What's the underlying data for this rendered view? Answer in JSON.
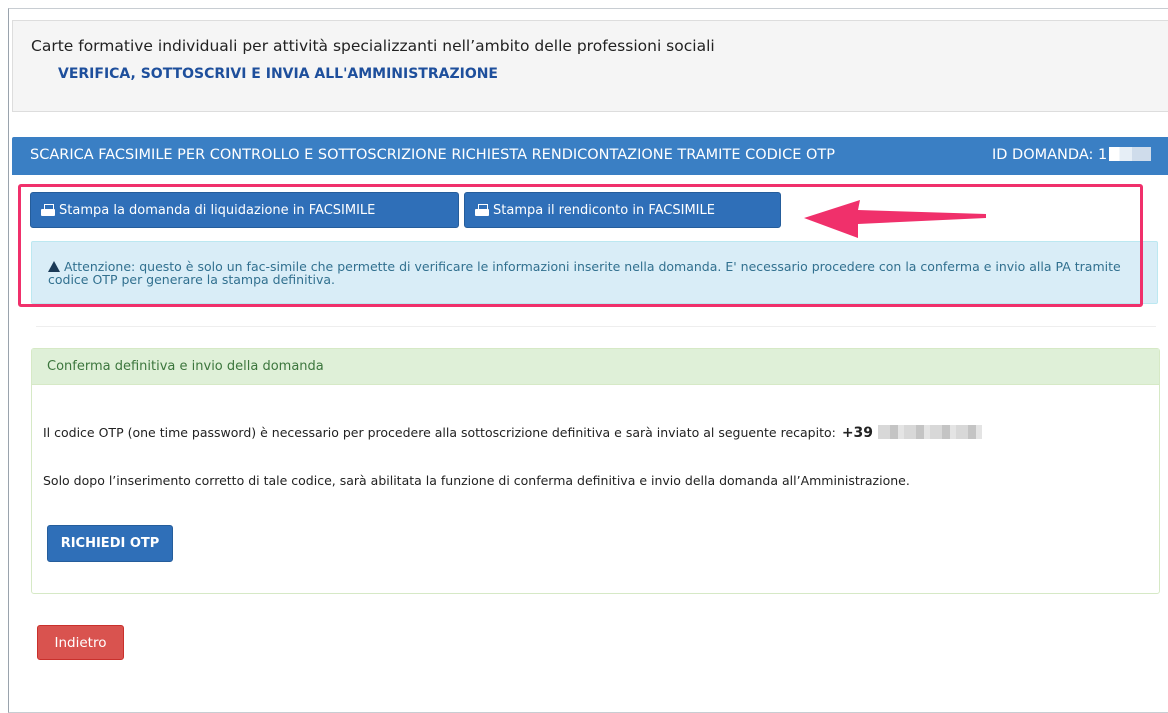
{
  "header": {
    "subtitle": "Carte formative individuali per attività specializzanti nell’ambito delle professioni sociali",
    "title": "VERIFICA, SOTTOSCRIVI E INVIA ALL'AMMINISTRAZIONE"
  },
  "section": {
    "title": "SCARICA FACSIMILE PER CONTROLLO E SOTTOSCRIZIONE RICHIESTA RENDICONTAZIONE TRAMITE CODICE OTP",
    "id_label": "ID DOMANDA: 1"
  },
  "actions": {
    "print_application_label": "Stampa la domanda di liquidazione in FACSIMILE",
    "print_report_label": "Stampa il rendiconto in FACSIMILE"
  },
  "alert": {
    "icon": "warning-icon",
    "text": "Attenzione: questo è solo un fac-simile che permette di verificare le informazioni inserite nella domanda. E' necessario procedere con la conferma e invio alla PA tramite codice OTP per generare la stampa definitiva."
  },
  "confirm": {
    "heading": "Conferma definitiva e invio della domanda",
    "otp_text": "Il codice OTP (one time password) è necessario per procedere alla sottoscrizione definitiva e sarà inviato al seguente recapito:",
    "phone_prefix": "+39",
    "enable_text": "Solo dopo l’inserimento corretto di tale codice, sarà abilitata la funzione di conferma definitiva e invio della domanda all’Amministrazione.",
    "request_otp_label": "RICHIEDI OTP"
  },
  "footer": {
    "back_label": "Indietro"
  },
  "colors": {
    "primary": "#3a7fc4",
    "button_blue": "#2f6fb8",
    "title_blue": "#1e4f9c",
    "highlight": "#f0306b",
    "danger": "#d9534f",
    "success_bg": "#dff0d8",
    "info_bg": "#d9edf7"
  }
}
